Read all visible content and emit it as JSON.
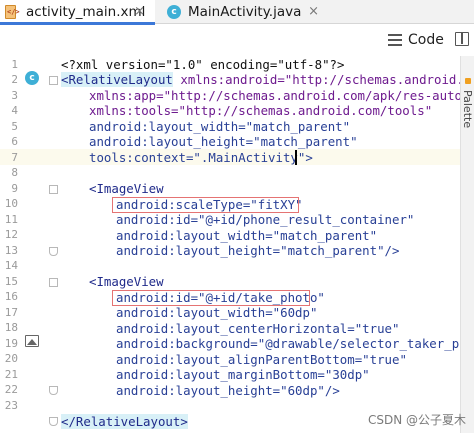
{
  "tabs": [
    {
      "label": "activity_main.xml",
      "icon": "xml-file-icon",
      "active": true
    },
    {
      "label": "MainActivity.java",
      "icon": "java-class-icon",
      "active": false
    }
  ],
  "close_glyph": "×",
  "view_mode_label": "Code",
  "side_panel_label": "Palette",
  "gutter_class_glyph": "c",
  "line_numbers": [
    "1",
    "2",
    "3",
    "4",
    "5",
    "6",
    "7",
    "8",
    "9",
    "10",
    "11",
    "12",
    "13",
    "14",
    "15",
    "16",
    "17",
    "18",
    "19",
    "20",
    "21",
    "22",
    "23"
  ],
  "code": {
    "l1": "<?xml version=\"1.0\" encoding=\"utf-8\"?>",
    "l2_tag": "<RelativeLayout",
    "l2_rest": " xmlns:android=\"http://schemas.android.com/",
    "l3": "xmlns:app=\"http://schemas.android.com/apk/res-auto\"",
    "l4": "xmlns:tools=\"http://schemas.android.com/tools\"",
    "l5": "android:layout_width=\"match_parent\"",
    "l6": "android:layout_height=\"match_parent\"",
    "l7": "tools:context=\".MainActivity\">",
    "l9": "<ImageView",
    "l10": "android:scaleType=\"fitXY\"",
    "l11": "android:id=\"@+id/phone_result_container\"",
    "l12": "android:layout_width=\"match_parent\"",
    "l13": "android:layout_height=\"match_parent\"/>",
    "l15": "<ImageView",
    "l16": "android:id=\"@+id/take_photo\"",
    "l17": "android:layout_width=\"60dp\"",
    "l18": "android:layout_centerHorizontal=\"true\"",
    "l19": "android:background=\"@drawable/selector_taker_photo",
    "l20": "android:layout_alignParentBottom=\"true\"",
    "l21": "android:layout_marginBottom=\"30dp\"",
    "l22": "android:layout_height=\"60dp\"/>",
    "l24": "</RelativeLayout>"
  },
  "watermark": "CSDN @公子夏木"
}
